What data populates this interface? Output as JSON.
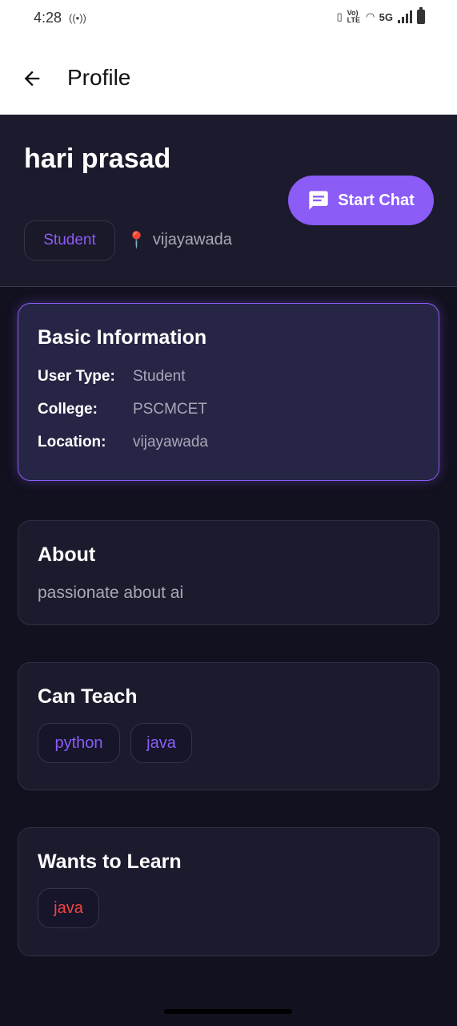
{
  "status_bar": {
    "time": "4:28",
    "network": "5G",
    "lte_label": "Vo) LTE"
  },
  "app_bar": {
    "title": "Profile",
    "back_icon": "arrow-left-icon"
  },
  "profile": {
    "name": "hari prasad",
    "role": "Student",
    "location": "vijayawada",
    "location_icon": "pin-icon",
    "start_chat_label": "Start Chat",
    "chat_icon": "chat-bubble-icon"
  },
  "basic_info": {
    "title": "Basic Information",
    "rows": [
      {
        "label": "User Type:",
        "value": "Student"
      },
      {
        "label": "College:",
        "value": "PSCMCET"
      },
      {
        "label": "Location:",
        "value": "vijayawada"
      }
    ]
  },
  "about": {
    "title": "About",
    "text": "passionate about ai"
  },
  "can_teach": {
    "title": "Can Teach",
    "skills": [
      "python",
      "java"
    ]
  },
  "wants_to_learn": {
    "title": "Wants to Learn",
    "skills": [
      "java"
    ]
  },
  "colors": {
    "accent": "#8b5cf6",
    "learn_tag": "#ef4444",
    "background": "#12111f",
    "card": "#1c1b2e"
  }
}
